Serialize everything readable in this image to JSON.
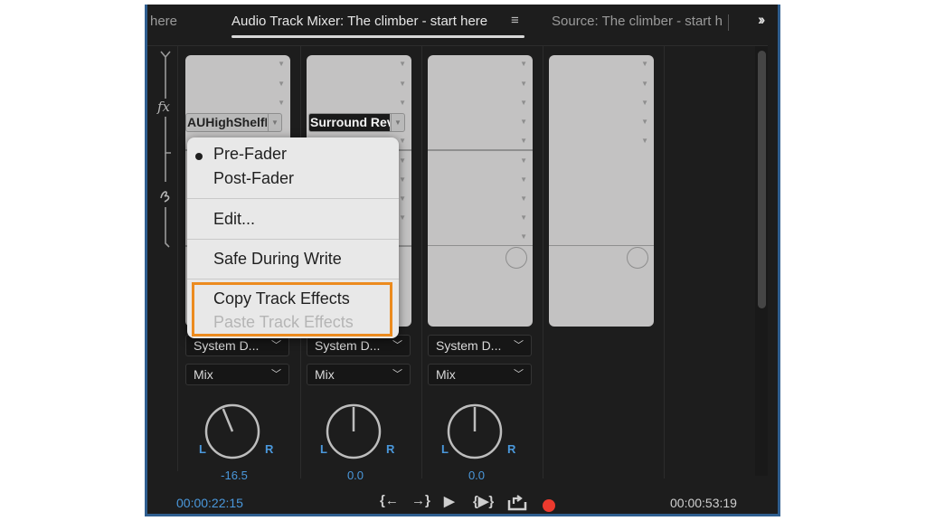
{
  "tabs": {
    "left_partial": "here",
    "active": "Audio Track Mixer: The climber - start here",
    "source": "Source: The climber - start h",
    "menu_icon": "hamburger-icon",
    "overflow_icon": "double-chevron-right-icon"
  },
  "sidebar": {
    "effects_icon": "fx-icon",
    "sends_icon": "sends-icon"
  },
  "tracks": [
    {
      "effect_slot": "AUHighShelfF",
      "output": "System D...",
      "mode": "Mix",
      "pan_value": "-16.5",
      "pan_fraction": -0.165
    },
    {
      "effect_slot": "Surround Rev",
      "output": "System D...",
      "mode": "Mix",
      "pan_value": "0.0",
      "pan_fraction": 0
    },
    {
      "effect_slot": "",
      "output": "System D...",
      "mode": "Mix",
      "pan_value": "0.0",
      "pan_fraction": 0
    },
    {
      "effect_slot": "",
      "output": "",
      "mode": "",
      "pan_value": "",
      "pan_fraction": null
    }
  ],
  "pan_labels": {
    "left": "L",
    "right": "R"
  },
  "context_menu": {
    "items": [
      {
        "label": "Pre-Fader",
        "checked": true
      },
      {
        "label": "Post-Fader",
        "checked": false
      },
      {
        "label": "Edit...",
        "checked": false
      },
      {
        "label": "Safe During Write",
        "checked": false
      },
      {
        "label": "Copy Track Effects",
        "checked": false
      },
      {
        "label": "Paste Track Effects",
        "checked": false,
        "disabled": true
      }
    ]
  },
  "footer": {
    "current_time": "00:00:22:15",
    "duration": "00:00:53:19",
    "transport": {
      "go_to_in": "{←",
      "go_to_out": "→}",
      "play": "▶",
      "play_in_to_out": "{▶}",
      "loop": "loop-icon",
      "record": "record-icon"
    }
  },
  "colors": {
    "accent_blue": "#4a98dc",
    "record_red": "#ec3a2e",
    "highlight_orange": "#ec8b1f",
    "panel_border": "#2f5e8f"
  }
}
